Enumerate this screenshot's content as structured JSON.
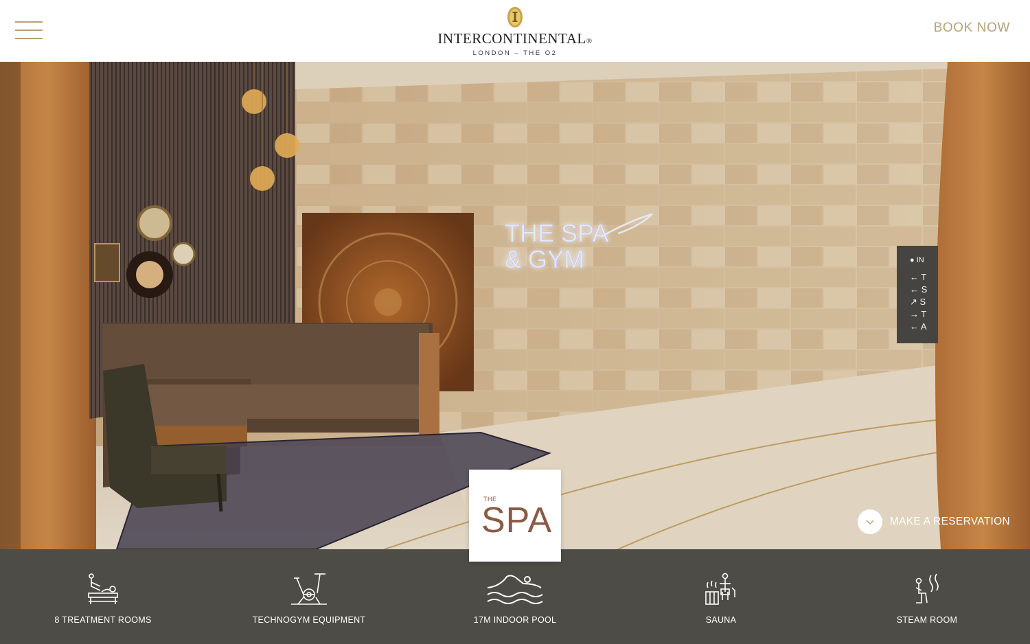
{
  "header": {
    "menu_icon": "hamburger-icon",
    "brand_name": "INTERCONTINENTAL",
    "brand_mark": "®",
    "brand_location": "LONDON – THE O2",
    "book_now_label": "BOOK NOW",
    "accent_color": "#b9a074"
  },
  "hero": {
    "sign_line1": "THE SPA",
    "sign_line2": "& GYM",
    "reservation_label": "MAKE A RESERVATION",
    "reservation_icon": "chevron-down-icon"
  },
  "spa_badge": {
    "small_text": "THE",
    "big_text": "SPA",
    "color": "#8c5a43"
  },
  "amenities": [
    {
      "label": "8 TREATMENT ROOMS",
      "icon": "massage-icon"
    },
    {
      "label": "TECHNOGYM EQUIPMENT",
      "icon": "exercise-bike-icon"
    },
    {
      "label": "17M INDOOR POOL",
      "icon": "swimmer-icon"
    },
    {
      "label": "SAUNA",
      "icon": "sauna-icon"
    },
    {
      "label": "STEAM ROOM",
      "icon": "steam-room-icon"
    }
  ],
  "amenity_bar_color": "#4d4c46"
}
